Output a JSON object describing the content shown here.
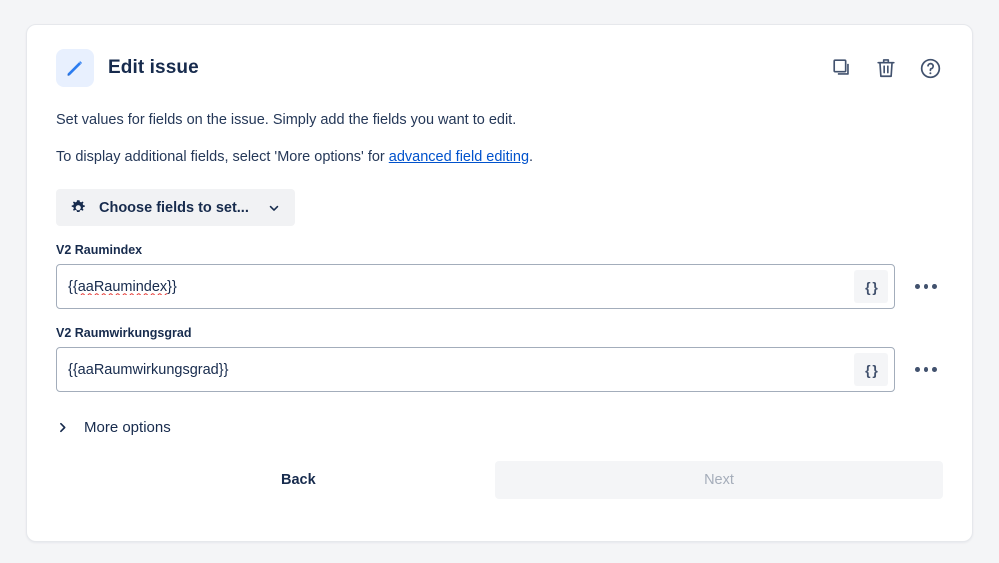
{
  "header": {
    "title": "Edit issue",
    "icon": "pencil-icon",
    "actions": [
      {
        "name": "duplicate-icon",
        "label": "Duplicate"
      },
      {
        "name": "trash-icon",
        "label": "Delete"
      },
      {
        "name": "help-icon",
        "label": "Help"
      }
    ]
  },
  "description": {
    "line1": "Set values for fields on the issue. Simply add the fields you want to edit.",
    "line2_prefix": "To display additional fields, select 'More options' for ",
    "line2_link": "advanced field editing",
    "line2_suffix": "."
  },
  "choose_fields": {
    "label": "Choose fields to set...",
    "icon": "gear-icon",
    "chevron": "chevron-down-icon"
  },
  "fields": [
    {
      "label": "V2 Raumindex",
      "value": "{{aaRaumindex}}",
      "value_prefix": "{{",
      "value_spellchecked": "aaRaumindex",
      "value_suffix": "}}",
      "has_spellcheck_error": true,
      "braces_label": "{ }",
      "more_label": "More"
    },
    {
      "label": "V2 Raumwirkungsgrad",
      "value": "{{aaRaumwirkungsgrad}}",
      "value_prefix": "{{",
      "value_spellchecked": "aaRaumwirkungsgrad",
      "value_suffix": "}}",
      "has_spellcheck_error": false,
      "braces_label": "{ }",
      "more_label": "More"
    }
  ],
  "more_options": {
    "label": "More options",
    "icon": "chevron-right-icon",
    "expanded": false
  },
  "footer": {
    "back_label": "Back",
    "next_label": "Next",
    "next_disabled": true
  },
  "colors": {
    "page_background": "#f4f5f7",
    "card_background": "#ffffff",
    "accent_blue": "#2b7cf0",
    "link_blue": "#0052cc",
    "text_dark": "#172b4d",
    "icon_gray": "#42526e",
    "disabled_text": "#a5adba",
    "spellcheck_red": "#e53935"
  }
}
